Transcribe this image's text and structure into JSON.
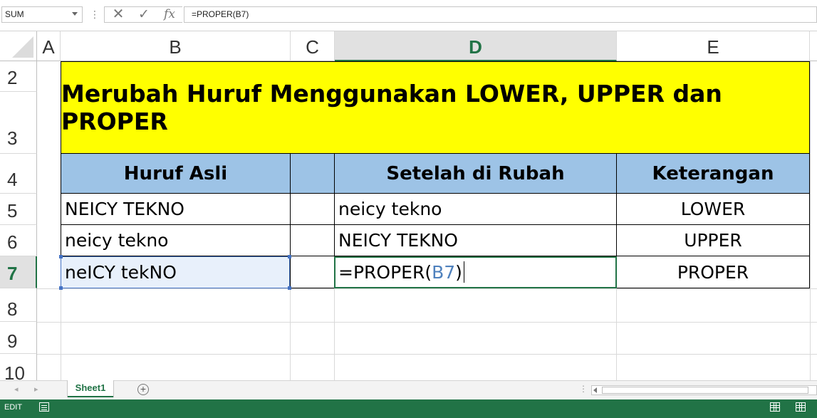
{
  "formula_bar": {
    "name_box": "SUM",
    "cancel_glyph": "✕",
    "enter_glyph": "✓",
    "fx_label": "fx",
    "formula": "=PROPER(B7)"
  },
  "columns": [
    "A",
    "B",
    "C",
    "D",
    "E"
  ],
  "active_column": "D",
  "rows": [
    "2",
    "3",
    "4",
    "5",
    "6",
    "7",
    "8",
    "9",
    "10"
  ],
  "active_row": "7",
  "title": "Merubah Huruf Menggunakan LOWER, UPPER dan PROPER",
  "table": {
    "headers": [
      "Huruf Asli",
      "Setelah di Rubah",
      "Keterangan"
    ],
    "rows": [
      {
        "original": "NEICY TEKNO",
        "result": "neicy tekno",
        "note": "LOWER"
      },
      {
        "original": "neicy tekno",
        "result": "NEICY TEKNO",
        "note": "UPPER"
      },
      {
        "original": "neICY tekNO",
        "result": "=PROPER(B7)",
        "note": "PROPER"
      }
    ],
    "editing_formula": {
      "prefix": "=PROPER(",
      "ref": "B7",
      "suffix": ")"
    }
  },
  "sheet_tabs": {
    "prev_arrow": "◂",
    "next_arrow": "▸",
    "active_tab": "Sheet1",
    "add_glyph": "+",
    "scroll_dots": "⋮"
  },
  "status_bar": {
    "mode": "EDIT",
    "accent_color": "#217346"
  },
  "colors": {
    "title_fill": "#ffff00",
    "header_fill": "#9dc3e6",
    "selection_border": "#217346",
    "reference_color": "#4472c4"
  }
}
